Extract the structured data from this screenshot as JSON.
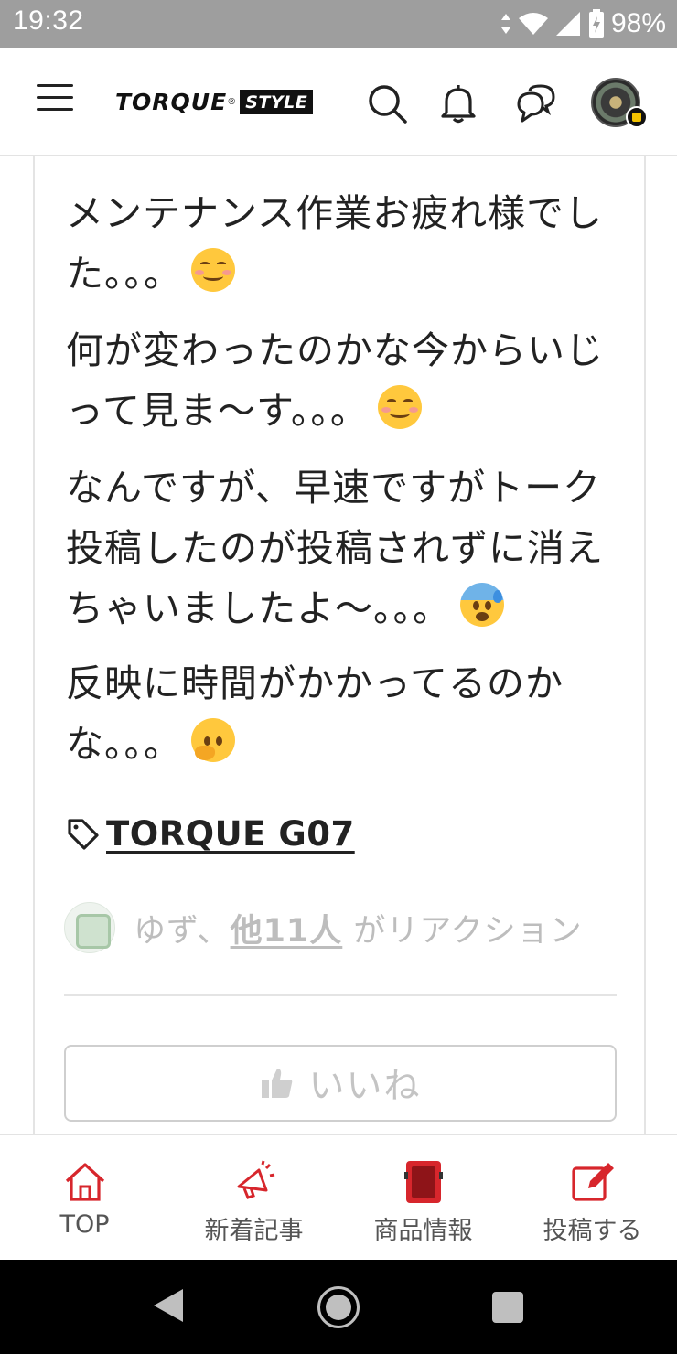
{
  "status_bar": {
    "time": "19:32",
    "battery": "98%"
  },
  "header": {
    "logo_main": "TORQUE",
    "logo_reg": "®",
    "logo_sub": "STYLE"
  },
  "post": {
    "paragraphs": [
      {
        "text": "メンテナンス作業お疲れ様でした。。。",
        "emoji": "smiling-face-emoji"
      },
      {
        "text": "何が変わったのかな今からいじって見ま～す。。。",
        "emoji": "smiling-face-emoji"
      },
      {
        "text": "なんですが、早速ですがトーク投稿したのが投稿されずに消えちゃいましたよ～。。。",
        "emoji": "anxious-face-with-sweat-emoji"
      },
      {
        "text": "反映に時間がかかってるのかな。。。",
        "emoji": "thinking-face-emoji"
      }
    ],
    "tag": "TORQUE G07",
    "reactions": {
      "prefix": "ゆず、",
      "link": "他11人",
      "suffix": " がリアクション"
    },
    "like_button": "いいね"
  },
  "bottom_nav": {
    "items": [
      {
        "label": "TOP",
        "icon": "home-icon"
      },
      {
        "label": "新着記事",
        "icon": "megaphone-icon"
      },
      {
        "label": "商品情報",
        "icon": "phone-product-icon"
      },
      {
        "label": "投稿する",
        "icon": "compose-icon"
      }
    ]
  },
  "colors": {
    "accent": "#d7262c",
    "status_bar": "#9e9e9e",
    "muted_text": "#bdbdbd"
  }
}
